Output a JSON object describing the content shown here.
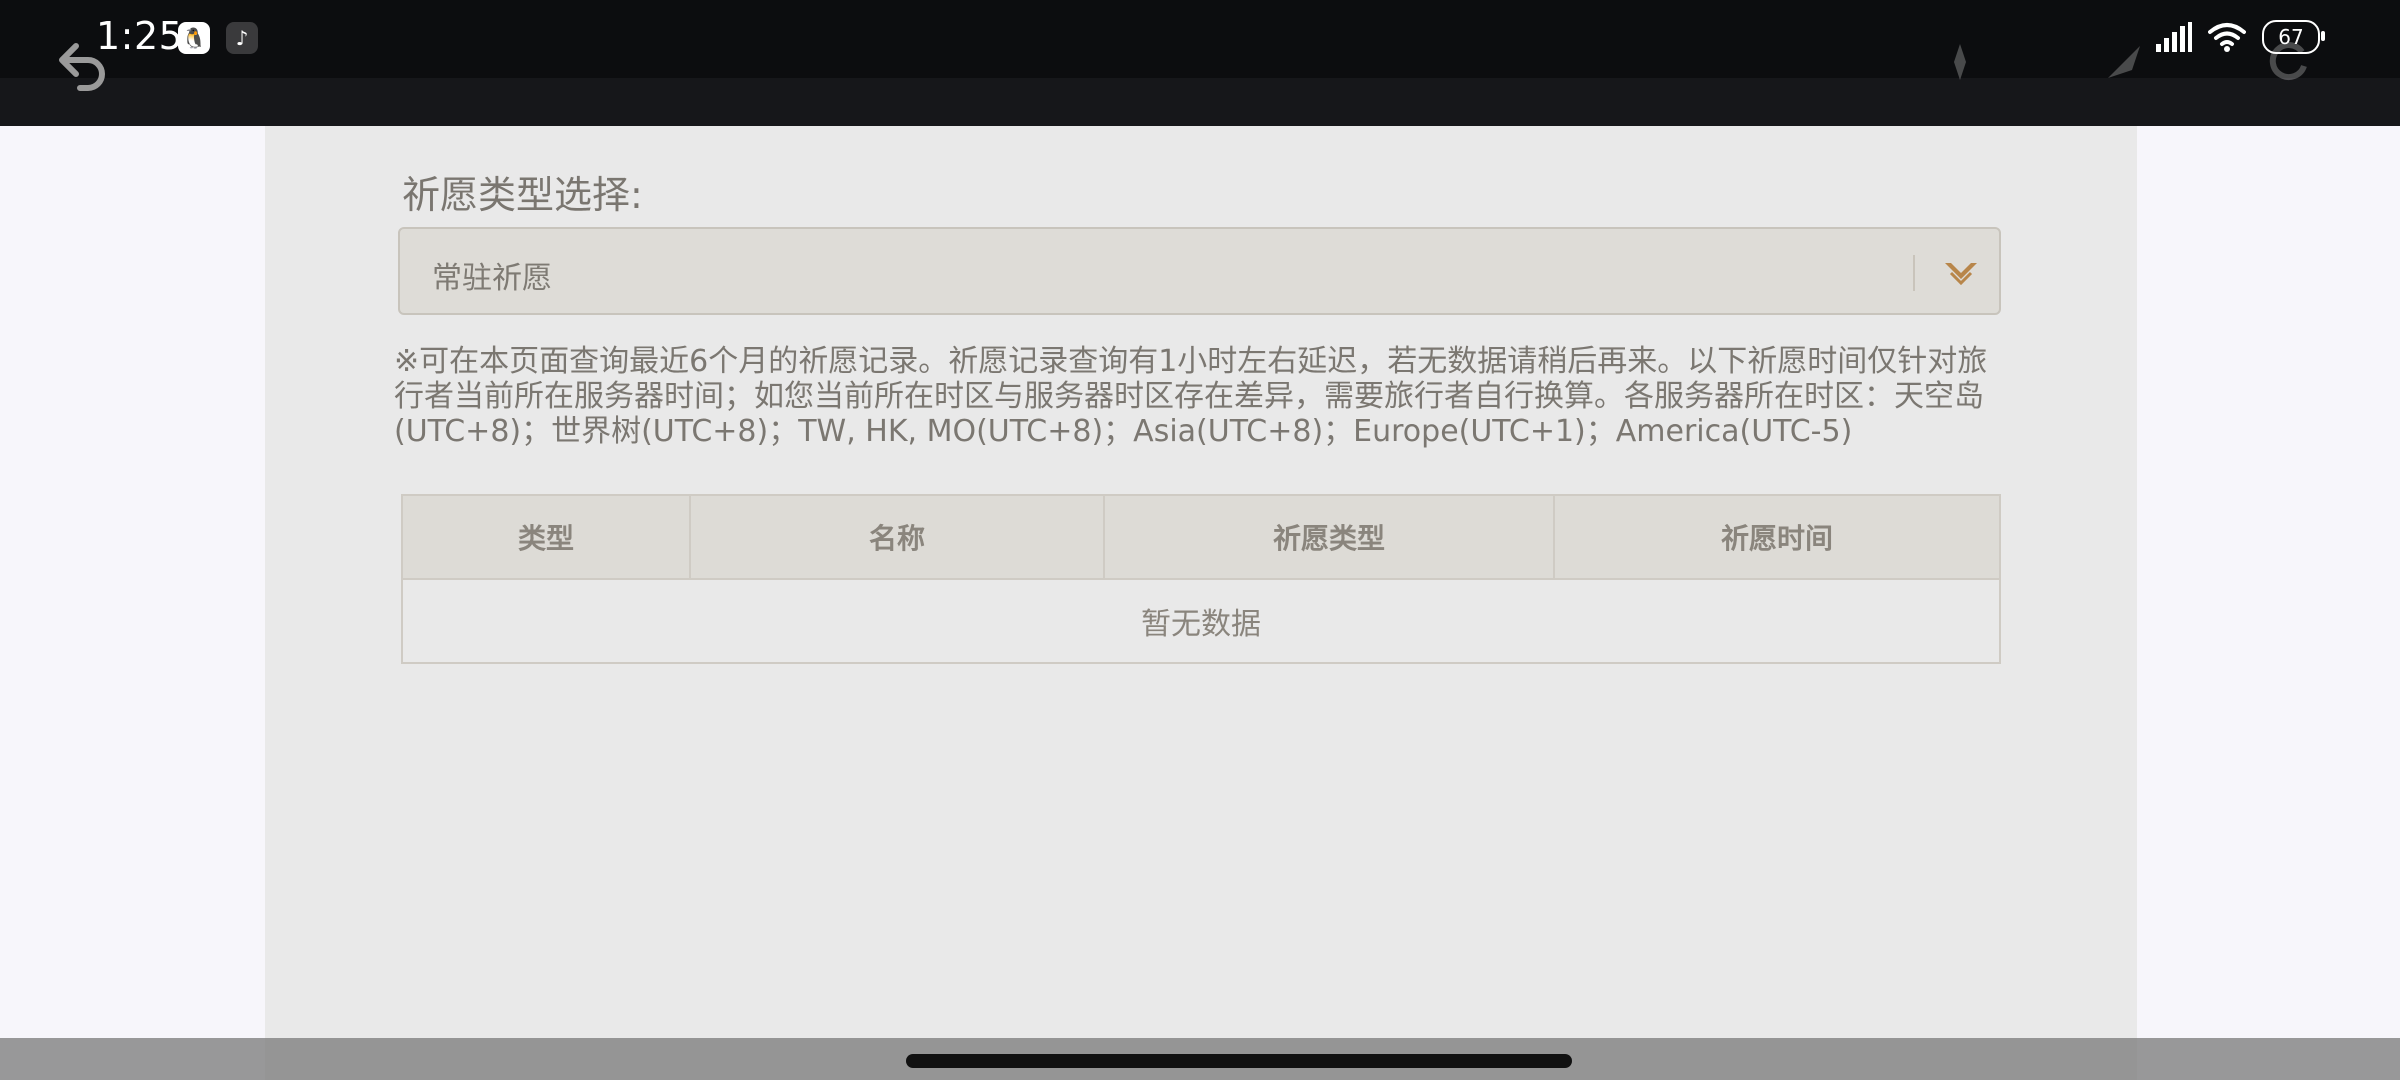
{
  "status_bar": {
    "time": "1:25",
    "battery": "67",
    "apps": [
      "qq-icon",
      "tiktok-icon"
    ]
  },
  "wish": {
    "type_label": "祈愿类型选择:",
    "selected_type": "常驻祈愿",
    "notice": "※可在本页面查询最近6个月的祈愿记录。祈愿记录查询有1小时左右延迟，若无数据请稍后再来。以下祈愿时间仅针对旅行者当前所在服务器时间；如您当前所在时区与服务器时区存在差异，需要旅行者自行换算。各服务器所在时区：天空岛(UTC+8)；世界树(UTC+8)；TW, HK, MO(UTC+8)；Asia(UTC+8)；Europe(UTC+1)；America(UTC-5)",
    "table": {
      "headers": [
        "类型",
        "名称",
        "祈愿类型",
        "祈愿时间"
      ],
      "empty_text": "暂无数据"
    }
  },
  "colors": {
    "panel_bg": "#e9e9e9",
    "select_bg": "#dedcd7",
    "accent_arrow": "#b8864a",
    "text": "#7b7771"
  }
}
